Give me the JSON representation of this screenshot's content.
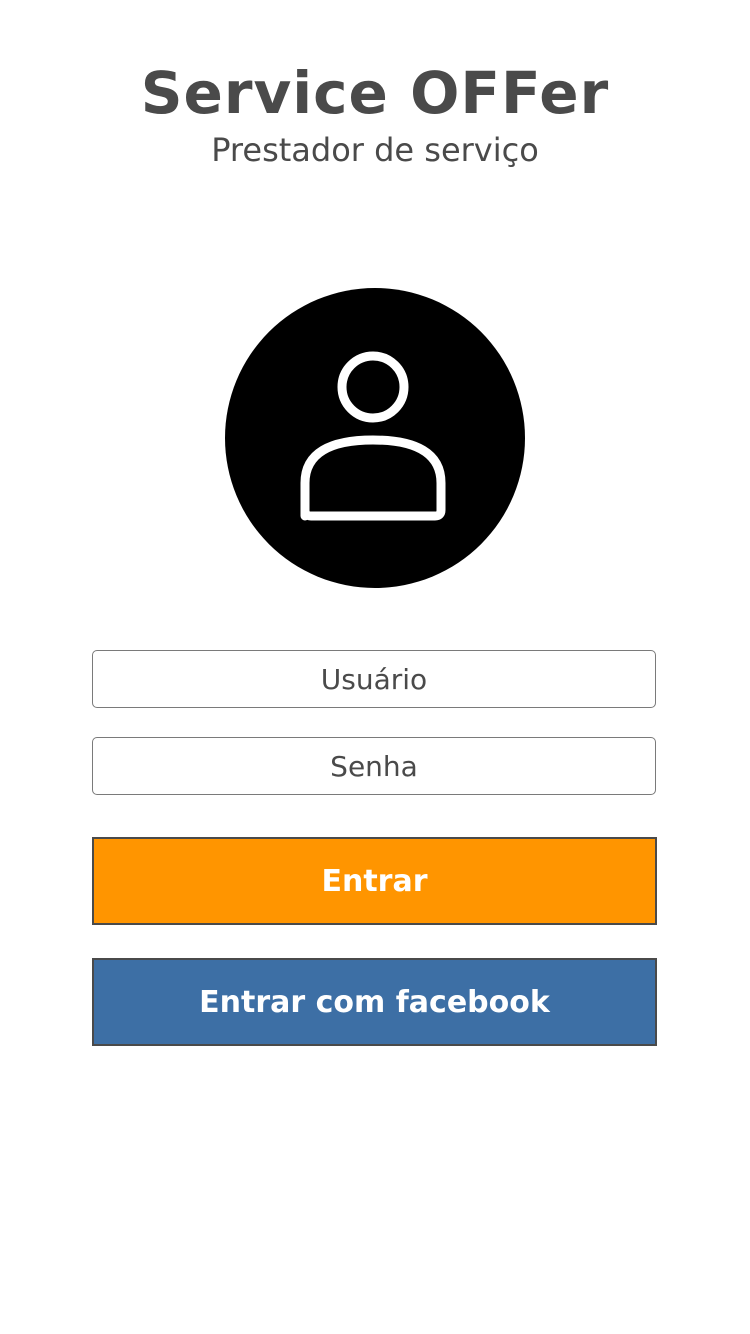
{
  "header": {
    "title": "Service OFFer",
    "subtitle": "Prestador de serviço"
  },
  "avatar": {
    "icon": "user-icon",
    "background_color": "#000000"
  },
  "form": {
    "user_placeholder": "Usuário",
    "password_placeholder": "Senha"
  },
  "buttons": {
    "login_label": "Entrar",
    "login_color": "#ff9500",
    "facebook_label": "Entrar com facebook",
    "facebook_color": "#3d6fa5"
  }
}
